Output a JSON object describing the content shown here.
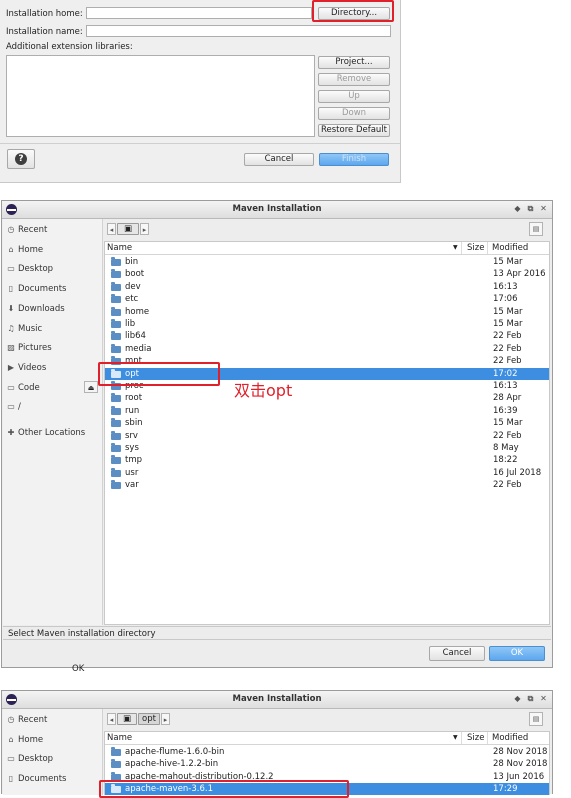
{
  "section1": {
    "installation_home_label": "Installation home:",
    "installation_name_label": "Installation name:",
    "additional_libs_label": "Additional extension libraries:",
    "directory_button": "Directory...",
    "project_button": "Project...",
    "remove_button": "Remove",
    "up_button": "Up",
    "down_button": "Down",
    "restore_default_button": "Restore Default",
    "help_icon": "question-icon",
    "cancel_button": "Cancel",
    "finish_button": "Finish"
  },
  "dialog1": {
    "title": "Maven Installation",
    "sidebar": [
      {
        "label": "Recent",
        "icon": "clock-icon"
      },
      {
        "label": "Home",
        "icon": "home-icon"
      },
      {
        "label": "Desktop",
        "icon": "desktop-icon"
      },
      {
        "label": "Documents",
        "icon": "document-icon"
      },
      {
        "label": "Downloads",
        "icon": "download-icon"
      },
      {
        "label": "Music",
        "icon": "music-icon"
      },
      {
        "label": "Pictures",
        "icon": "picture-icon"
      },
      {
        "label": "Videos",
        "icon": "video-icon"
      },
      {
        "label": "Code",
        "icon": "drive-icon"
      },
      {
        "label": "/",
        "icon": "drive-icon"
      },
      {
        "label": "Other Locations",
        "icon": "plus-icon"
      }
    ],
    "column_name": "Name",
    "column_size": "Size",
    "column_modified": "Modified",
    "files": [
      {
        "name": "bin",
        "modified": "15 Mar"
      },
      {
        "name": "boot",
        "modified": "13 Apr 2016"
      },
      {
        "name": "dev",
        "modified": "16:13"
      },
      {
        "name": "etc",
        "modified": "17:06"
      },
      {
        "name": "home",
        "modified": "15 Mar"
      },
      {
        "name": "lib",
        "modified": "15 Mar"
      },
      {
        "name": "lib64",
        "modified": "22 Feb"
      },
      {
        "name": "media",
        "modified": "22 Feb"
      },
      {
        "name": "mnt",
        "modified": "22 Feb"
      },
      {
        "name": "opt",
        "modified": "17:02"
      },
      {
        "name": "proc",
        "modified": "16:13"
      },
      {
        "name": "root",
        "modified": "28 Apr"
      },
      {
        "name": "run",
        "modified": "16:39"
      },
      {
        "name": "sbin",
        "modified": "15 Mar"
      },
      {
        "name": "srv",
        "modified": "22 Feb"
      },
      {
        "name": "sys",
        "modified": "8 May"
      },
      {
        "name": "tmp",
        "modified": "18:22"
      },
      {
        "name": "usr",
        "modified": "16 Jul 2018"
      },
      {
        "name": "var",
        "modified": "22 Feb"
      }
    ],
    "selected_index": 9,
    "annotation": "双击opt",
    "status": "Select Maven installation directory",
    "cancel_button": "Cancel",
    "ok_button": "OK"
  },
  "gap_text": "OK",
  "dialog2": {
    "title": "Maven Installation",
    "sidebar": [
      {
        "label": "Recent",
        "icon": "clock-icon"
      },
      {
        "label": "Home",
        "icon": "home-icon"
      },
      {
        "label": "Desktop",
        "icon": "desktop-icon"
      },
      {
        "label": "Documents",
        "icon": "document-icon"
      }
    ],
    "crumb": "opt",
    "column_name": "Name",
    "column_size": "Size",
    "column_modified": "Modified",
    "files": [
      {
        "name": "apache-flume-1.6.0-bin",
        "modified": "28 Nov 2018"
      },
      {
        "name": "apache-hive-1.2.2-bin",
        "modified": "28 Nov 2018"
      },
      {
        "name": "apache-mahout-distribution-0.12.2",
        "modified": "13 Jun 2016"
      },
      {
        "name": "apache-maven-3.6.1",
        "modified": "17:29"
      }
    ],
    "selected_index": 3
  }
}
